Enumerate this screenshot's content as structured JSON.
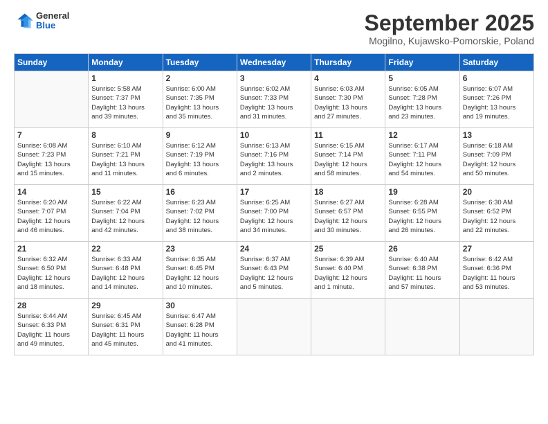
{
  "header": {
    "logo": {
      "general": "General",
      "blue": "Blue"
    },
    "title": "September 2025",
    "location": "Mogilno, Kujawsko-Pomorskie, Poland"
  },
  "days_of_week": [
    "Sunday",
    "Monday",
    "Tuesday",
    "Wednesday",
    "Thursday",
    "Friday",
    "Saturday"
  ],
  "weeks": [
    [
      {
        "day": "",
        "info": ""
      },
      {
        "day": "1",
        "info": "Sunrise: 5:58 AM\nSunset: 7:37 PM\nDaylight: 13 hours\nand 39 minutes."
      },
      {
        "day": "2",
        "info": "Sunrise: 6:00 AM\nSunset: 7:35 PM\nDaylight: 13 hours\nand 35 minutes."
      },
      {
        "day": "3",
        "info": "Sunrise: 6:02 AM\nSunset: 7:33 PM\nDaylight: 13 hours\nand 31 minutes."
      },
      {
        "day": "4",
        "info": "Sunrise: 6:03 AM\nSunset: 7:30 PM\nDaylight: 13 hours\nand 27 minutes."
      },
      {
        "day": "5",
        "info": "Sunrise: 6:05 AM\nSunset: 7:28 PM\nDaylight: 13 hours\nand 23 minutes."
      },
      {
        "day": "6",
        "info": "Sunrise: 6:07 AM\nSunset: 7:26 PM\nDaylight: 13 hours\nand 19 minutes."
      }
    ],
    [
      {
        "day": "7",
        "info": "Sunrise: 6:08 AM\nSunset: 7:23 PM\nDaylight: 13 hours\nand 15 minutes."
      },
      {
        "day": "8",
        "info": "Sunrise: 6:10 AM\nSunset: 7:21 PM\nDaylight: 13 hours\nand 11 minutes."
      },
      {
        "day": "9",
        "info": "Sunrise: 6:12 AM\nSunset: 7:19 PM\nDaylight: 13 hours\nand 6 minutes."
      },
      {
        "day": "10",
        "info": "Sunrise: 6:13 AM\nSunset: 7:16 PM\nDaylight: 13 hours\nand 2 minutes."
      },
      {
        "day": "11",
        "info": "Sunrise: 6:15 AM\nSunset: 7:14 PM\nDaylight: 12 hours\nand 58 minutes."
      },
      {
        "day": "12",
        "info": "Sunrise: 6:17 AM\nSunset: 7:11 PM\nDaylight: 12 hours\nand 54 minutes."
      },
      {
        "day": "13",
        "info": "Sunrise: 6:18 AM\nSunset: 7:09 PM\nDaylight: 12 hours\nand 50 minutes."
      }
    ],
    [
      {
        "day": "14",
        "info": "Sunrise: 6:20 AM\nSunset: 7:07 PM\nDaylight: 12 hours\nand 46 minutes."
      },
      {
        "day": "15",
        "info": "Sunrise: 6:22 AM\nSunset: 7:04 PM\nDaylight: 12 hours\nand 42 minutes."
      },
      {
        "day": "16",
        "info": "Sunrise: 6:23 AM\nSunset: 7:02 PM\nDaylight: 12 hours\nand 38 minutes."
      },
      {
        "day": "17",
        "info": "Sunrise: 6:25 AM\nSunset: 7:00 PM\nDaylight: 12 hours\nand 34 minutes."
      },
      {
        "day": "18",
        "info": "Sunrise: 6:27 AM\nSunset: 6:57 PM\nDaylight: 12 hours\nand 30 minutes."
      },
      {
        "day": "19",
        "info": "Sunrise: 6:28 AM\nSunset: 6:55 PM\nDaylight: 12 hours\nand 26 minutes."
      },
      {
        "day": "20",
        "info": "Sunrise: 6:30 AM\nSunset: 6:52 PM\nDaylight: 12 hours\nand 22 minutes."
      }
    ],
    [
      {
        "day": "21",
        "info": "Sunrise: 6:32 AM\nSunset: 6:50 PM\nDaylight: 12 hours\nand 18 minutes."
      },
      {
        "day": "22",
        "info": "Sunrise: 6:33 AM\nSunset: 6:48 PM\nDaylight: 12 hours\nand 14 minutes."
      },
      {
        "day": "23",
        "info": "Sunrise: 6:35 AM\nSunset: 6:45 PM\nDaylight: 12 hours\nand 10 minutes."
      },
      {
        "day": "24",
        "info": "Sunrise: 6:37 AM\nSunset: 6:43 PM\nDaylight: 12 hours\nand 5 minutes."
      },
      {
        "day": "25",
        "info": "Sunrise: 6:39 AM\nSunset: 6:40 PM\nDaylight: 12 hours\nand 1 minute."
      },
      {
        "day": "26",
        "info": "Sunrise: 6:40 AM\nSunset: 6:38 PM\nDaylight: 11 hours\nand 57 minutes."
      },
      {
        "day": "27",
        "info": "Sunrise: 6:42 AM\nSunset: 6:36 PM\nDaylight: 11 hours\nand 53 minutes."
      }
    ],
    [
      {
        "day": "28",
        "info": "Sunrise: 6:44 AM\nSunset: 6:33 PM\nDaylight: 11 hours\nand 49 minutes."
      },
      {
        "day": "29",
        "info": "Sunrise: 6:45 AM\nSunset: 6:31 PM\nDaylight: 11 hours\nand 45 minutes."
      },
      {
        "day": "30",
        "info": "Sunrise: 6:47 AM\nSunset: 6:28 PM\nDaylight: 11 hours\nand 41 minutes."
      },
      {
        "day": "",
        "info": ""
      },
      {
        "day": "",
        "info": ""
      },
      {
        "day": "",
        "info": ""
      },
      {
        "day": "",
        "info": ""
      }
    ]
  ]
}
